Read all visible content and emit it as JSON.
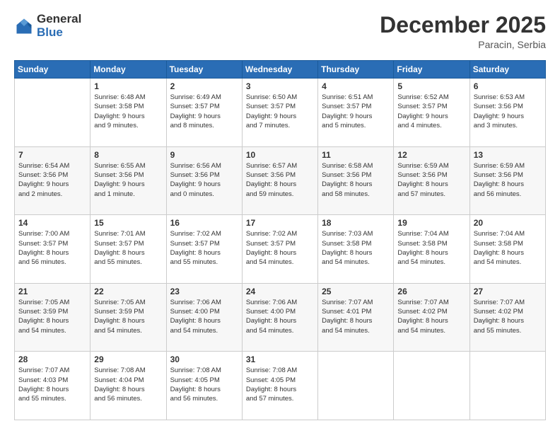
{
  "logo": {
    "general": "General",
    "blue": "Blue"
  },
  "header": {
    "month": "December 2025",
    "location": "Paracin, Serbia"
  },
  "weekdays": [
    "Sunday",
    "Monday",
    "Tuesday",
    "Wednesday",
    "Thursday",
    "Friday",
    "Saturday"
  ],
  "weeks": [
    [
      {
        "day": null,
        "info": null
      },
      {
        "day": "1",
        "info": "Sunrise: 6:48 AM\nSunset: 3:58 PM\nDaylight: 9 hours\nand 9 minutes."
      },
      {
        "day": "2",
        "info": "Sunrise: 6:49 AM\nSunset: 3:57 PM\nDaylight: 9 hours\nand 8 minutes."
      },
      {
        "day": "3",
        "info": "Sunrise: 6:50 AM\nSunset: 3:57 PM\nDaylight: 9 hours\nand 7 minutes."
      },
      {
        "day": "4",
        "info": "Sunrise: 6:51 AM\nSunset: 3:57 PM\nDaylight: 9 hours\nand 5 minutes."
      },
      {
        "day": "5",
        "info": "Sunrise: 6:52 AM\nSunset: 3:57 PM\nDaylight: 9 hours\nand 4 minutes."
      },
      {
        "day": "6",
        "info": "Sunrise: 6:53 AM\nSunset: 3:56 PM\nDaylight: 9 hours\nand 3 minutes."
      }
    ],
    [
      {
        "day": "7",
        "info": "Sunrise: 6:54 AM\nSunset: 3:56 PM\nDaylight: 9 hours\nand 2 minutes."
      },
      {
        "day": "8",
        "info": "Sunrise: 6:55 AM\nSunset: 3:56 PM\nDaylight: 9 hours\nand 1 minute."
      },
      {
        "day": "9",
        "info": "Sunrise: 6:56 AM\nSunset: 3:56 PM\nDaylight: 9 hours\nand 0 minutes."
      },
      {
        "day": "10",
        "info": "Sunrise: 6:57 AM\nSunset: 3:56 PM\nDaylight: 8 hours\nand 59 minutes."
      },
      {
        "day": "11",
        "info": "Sunrise: 6:58 AM\nSunset: 3:56 PM\nDaylight: 8 hours\nand 58 minutes."
      },
      {
        "day": "12",
        "info": "Sunrise: 6:59 AM\nSunset: 3:56 PM\nDaylight: 8 hours\nand 57 minutes."
      },
      {
        "day": "13",
        "info": "Sunrise: 6:59 AM\nSunset: 3:56 PM\nDaylight: 8 hours\nand 56 minutes."
      }
    ],
    [
      {
        "day": "14",
        "info": "Sunrise: 7:00 AM\nSunset: 3:57 PM\nDaylight: 8 hours\nand 56 minutes."
      },
      {
        "day": "15",
        "info": "Sunrise: 7:01 AM\nSunset: 3:57 PM\nDaylight: 8 hours\nand 55 minutes."
      },
      {
        "day": "16",
        "info": "Sunrise: 7:02 AM\nSunset: 3:57 PM\nDaylight: 8 hours\nand 55 minutes."
      },
      {
        "day": "17",
        "info": "Sunrise: 7:02 AM\nSunset: 3:57 PM\nDaylight: 8 hours\nand 54 minutes."
      },
      {
        "day": "18",
        "info": "Sunrise: 7:03 AM\nSunset: 3:58 PM\nDaylight: 8 hours\nand 54 minutes."
      },
      {
        "day": "19",
        "info": "Sunrise: 7:04 AM\nSunset: 3:58 PM\nDaylight: 8 hours\nand 54 minutes."
      },
      {
        "day": "20",
        "info": "Sunrise: 7:04 AM\nSunset: 3:58 PM\nDaylight: 8 hours\nand 54 minutes."
      }
    ],
    [
      {
        "day": "21",
        "info": "Sunrise: 7:05 AM\nSunset: 3:59 PM\nDaylight: 8 hours\nand 54 minutes."
      },
      {
        "day": "22",
        "info": "Sunrise: 7:05 AM\nSunset: 3:59 PM\nDaylight: 8 hours\nand 54 minutes."
      },
      {
        "day": "23",
        "info": "Sunrise: 7:06 AM\nSunset: 4:00 PM\nDaylight: 8 hours\nand 54 minutes."
      },
      {
        "day": "24",
        "info": "Sunrise: 7:06 AM\nSunset: 4:00 PM\nDaylight: 8 hours\nand 54 minutes."
      },
      {
        "day": "25",
        "info": "Sunrise: 7:07 AM\nSunset: 4:01 PM\nDaylight: 8 hours\nand 54 minutes."
      },
      {
        "day": "26",
        "info": "Sunrise: 7:07 AM\nSunset: 4:02 PM\nDaylight: 8 hours\nand 54 minutes."
      },
      {
        "day": "27",
        "info": "Sunrise: 7:07 AM\nSunset: 4:02 PM\nDaylight: 8 hours\nand 55 minutes."
      }
    ],
    [
      {
        "day": "28",
        "info": "Sunrise: 7:07 AM\nSunset: 4:03 PM\nDaylight: 8 hours\nand 55 minutes."
      },
      {
        "day": "29",
        "info": "Sunrise: 7:08 AM\nSunset: 4:04 PM\nDaylight: 8 hours\nand 56 minutes."
      },
      {
        "day": "30",
        "info": "Sunrise: 7:08 AM\nSunset: 4:05 PM\nDaylight: 8 hours\nand 56 minutes."
      },
      {
        "day": "31",
        "info": "Sunrise: 7:08 AM\nSunset: 4:05 PM\nDaylight: 8 hours\nand 57 minutes."
      },
      {
        "day": null,
        "info": null
      },
      {
        "day": null,
        "info": null
      },
      {
        "day": null,
        "info": null
      }
    ]
  ]
}
